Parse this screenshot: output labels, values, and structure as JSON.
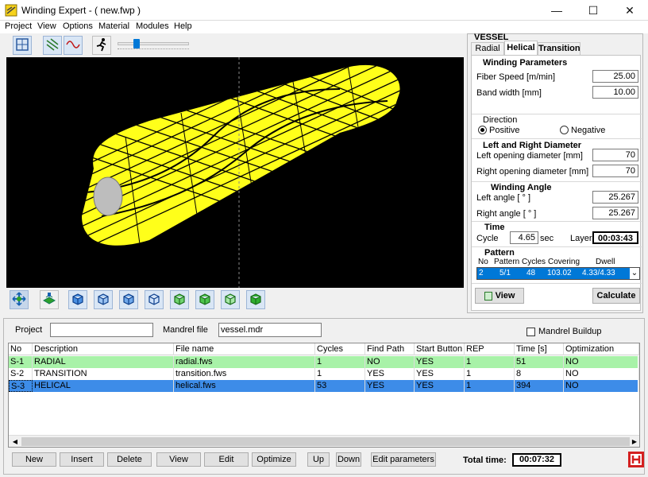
{
  "window": {
    "title": "Winding Expert  - ( new.fwp )",
    "minimize": "—",
    "maximize": "☐",
    "close": "✕"
  },
  "menu": [
    "Project",
    "View",
    "Options",
    "Material",
    "Modules",
    "Help"
  ],
  "panel": {
    "title": "VESSEL",
    "tabs": [
      "Radial",
      "Helical",
      "Transition"
    ],
    "active_tab": "Helical",
    "winding_params": {
      "title": "Winding Parameters",
      "fiber_speed_label": "Fiber Speed  [m/min]",
      "fiber_speed": "25.00",
      "band_width_label": "Band width [mm]",
      "band_width": "10.00"
    },
    "direction": {
      "title": "Direction",
      "positive": "Positive",
      "negative": "Negative",
      "selected": "Positive"
    },
    "diameter": {
      "title": "Left and Right Diameter",
      "left_label": "Left opening diameter  [mm]",
      "left_value": "70",
      "right_label": "Right opening diameter [mm]",
      "right_value": "70"
    },
    "angle": {
      "title": "Winding Angle",
      "left_label": "Left angle [ ° ]",
      "left_value": "25.267",
      "right_label": "Right angle [ ° ]",
      "right_value": "25.267"
    },
    "time": {
      "title": "Time",
      "cycle_label": "Cycle",
      "cycle_value": "4.65",
      "cycle_unit": "sec",
      "layer_label": "Layer",
      "layer_value": "00:03:43"
    },
    "pattern": {
      "title": "Pattern",
      "headers": [
        "No",
        "Pattern",
        "Cycles",
        "Covering",
        "Dwell"
      ],
      "selected": [
        "2",
        "5/1",
        "48",
        "103.02",
        "4.33/4.33"
      ]
    },
    "view_button": "View",
    "calculate_button": "Calculate"
  },
  "bottom": {
    "project_label": "Project",
    "project_value": "",
    "mandrel_label": "Mandrel file",
    "mandrel_value": "vessel.mdr",
    "buildup_label": "Mandrel Buildup",
    "columns": [
      "No",
      "Description",
      "File name",
      "Cycles",
      "Find Path",
      "Start Button",
      "REP",
      "Time [s]",
      "Optimization"
    ],
    "rows": [
      {
        "no": "S-1",
        "desc": "RADIAL",
        "file": "radial.fws",
        "cycles": "1",
        "find": "NO",
        "start": "YES",
        "rep": "1",
        "time": "51",
        "opt": "NO",
        "color": "#a8f2a8"
      },
      {
        "no": "S-2",
        "desc": "TRANSITION",
        "file": "transition.fws",
        "cycles": "1",
        "find": "YES",
        "start": "YES",
        "rep": "1",
        "time": "8",
        "opt": "NO",
        "color": "#ffffff"
      },
      {
        "no": "S-3",
        "desc": "HELICAL",
        "file": "helical.fws",
        "cycles": "53",
        "find": "YES",
        "start": "YES",
        "rep": "1",
        "time": "394",
        "opt": "NO",
        "color": "#3d8ce8"
      }
    ],
    "buttons": [
      "New",
      "Insert",
      "Delete",
      "View",
      "Edit",
      "Optimize",
      "Up",
      "Down",
      "Edit parameters"
    ],
    "total_time_label": "Total time:",
    "total_time_value": "00:07:32"
  },
  "colors": {
    "accent": "#0078d7",
    "viewport_bg": "#000000",
    "fiber": "#ffff1a",
    "selected_row": "#3d8ce8",
    "radial_row": "#a8f2a8",
    "logo": "#d42020"
  },
  "icons": {
    "toolbar": [
      "frame-icon",
      "helix-icon",
      "wave-icon",
      "runner-icon"
    ],
    "view_toolbar": [
      "move-icon",
      "layers-icon",
      "cube-blue-icon",
      "cube-blue-icon",
      "cube-blue-icon",
      "cube-blue-icon",
      "cube-green-icon",
      "cube-green-icon",
      "cube-green-icon",
      "cube-green-icon"
    ]
  }
}
